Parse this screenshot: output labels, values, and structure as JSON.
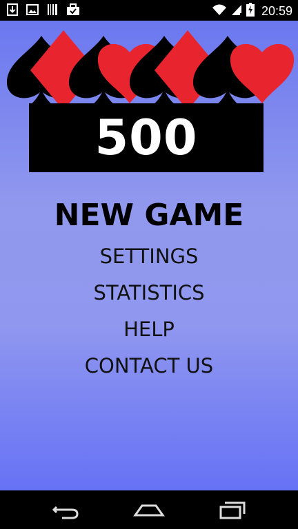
{
  "status_bar": {
    "time": "20:59",
    "icons": [
      "download-icon",
      "image-icon",
      "barcode-icon",
      "briefcase-icon",
      "wifi-icon",
      "signal-icon",
      "battery-charging-icon"
    ]
  },
  "logo": {
    "number": "500",
    "suit_colors": {
      "black": "#000000",
      "red": "#e8242e"
    }
  },
  "menu": {
    "new_game": "NEW GAME",
    "settings": "SETTINGS",
    "statistics": "STATISTICS",
    "help": "HELP",
    "contact_us": "CONTACT US"
  },
  "nav_bar": {
    "icons": [
      "back-icon",
      "home-icon",
      "recents-icon"
    ]
  }
}
